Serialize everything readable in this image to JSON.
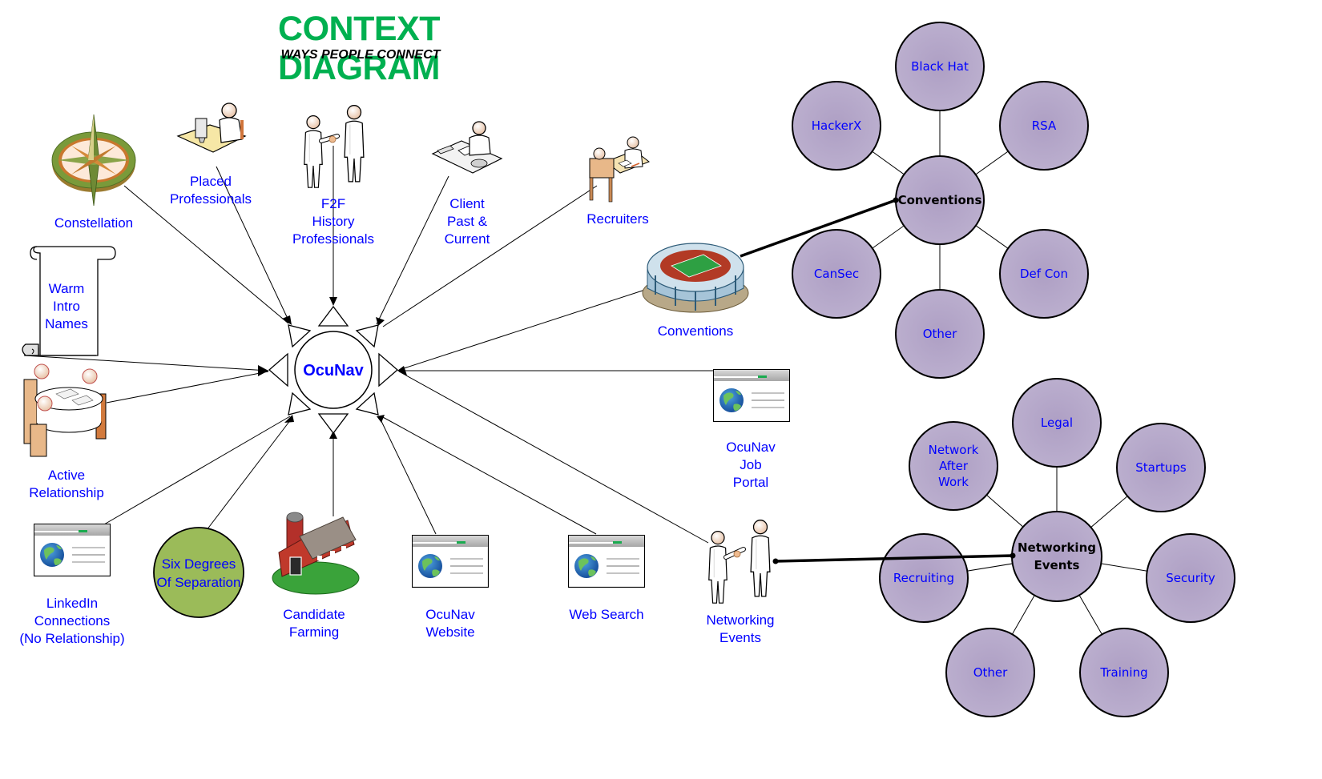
{
  "header": {
    "title": "CONTEXT DIAGRAM",
    "subtitle": "WAYS PEOPLE CONNECT"
  },
  "colors": {
    "title": "#00b050",
    "label_text": "#0000ff",
    "bubble_fill": "#b4a7c8",
    "six_degrees_fill": "#9bbb59",
    "line": "#000000"
  },
  "center": {
    "label": "OcuNav",
    "icon": "star-triangles-circle"
  },
  "sources": [
    {
      "id": "constellation",
      "label": "Constellation",
      "icon": "compass-rose-icon"
    },
    {
      "id": "placed",
      "label": "Placed\nProfessionals",
      "icon": "person-at-desk-icon"
    },
    {
      "id": "f2f",
      "label": "F2F\nHistory\nProfessionals",
      "icon": "handshake-icon"
    },
    {
      "id": "client",
      "label": "Client\nPast &\nCurrent",
      "icon": "person-at-desk-phone-icon"
    },
    {
      "id": "recruiters",
      "label": "Recruiters",
      "icon": "interview-desk-icon"
    },
    {
      "id": "warm",
      "label": "Warm\nIntro\nNames",
      "icon": "scroll-icon"
    },
    {
      "id": "active",
      "label": "Active\nRelationship",
      "icon": "meeting-table-icon"
    },
    {
      "id": "conventions",
      "label": "Conventions",
      "icon": "stadium-icon"
    },
    {
      "id": "jobportal",
      "label": "OcuNav\nJob\nPortal",
      "icon": "web-page-icon"
    },
    {
      "id": "linkedin",
      "label": "LinkedIn\nConnections\n(No Relationship)",
      "icon": "web-page-icon"
    },
    {
      "id": "sixdeg",
      "label": "Six Degrees\nOf Separation",
      "icon": "green-circle"
    },
    {
      "id": "farming",
      "label": "Candidate\nFarming",
      "icon": "barn-icon"
    },
    {
      "id": "website",
      "label": "OcuNav\nWebsite",
      "icon": "web-page-icon"
    },
    {
      "id": "websearch",
      "label": "Web Search",
      "icon": "web-page-icon"
    },
    {
      "id": "netevents",
      "label": "Networking\nEvents",
      "icon": "handshake-icon"
    }
  ],
  "conventions_cluster": {
    "hub": "Conventions",
    "items": [
      "Black Hat",
      "RSA",
      "Def Con",
      "Other",
      "CanSec",
      "HackerX"
    ]
  },
  "networking_cluster": {
    "hub": "Networking\nEvents",
    "items": [
      "Legal",
      "Startups",
      "Security",
      "Training",
      "Other",
      "Recruiting",
      "Network\nAfter\nWork"
    ]
  }
}
